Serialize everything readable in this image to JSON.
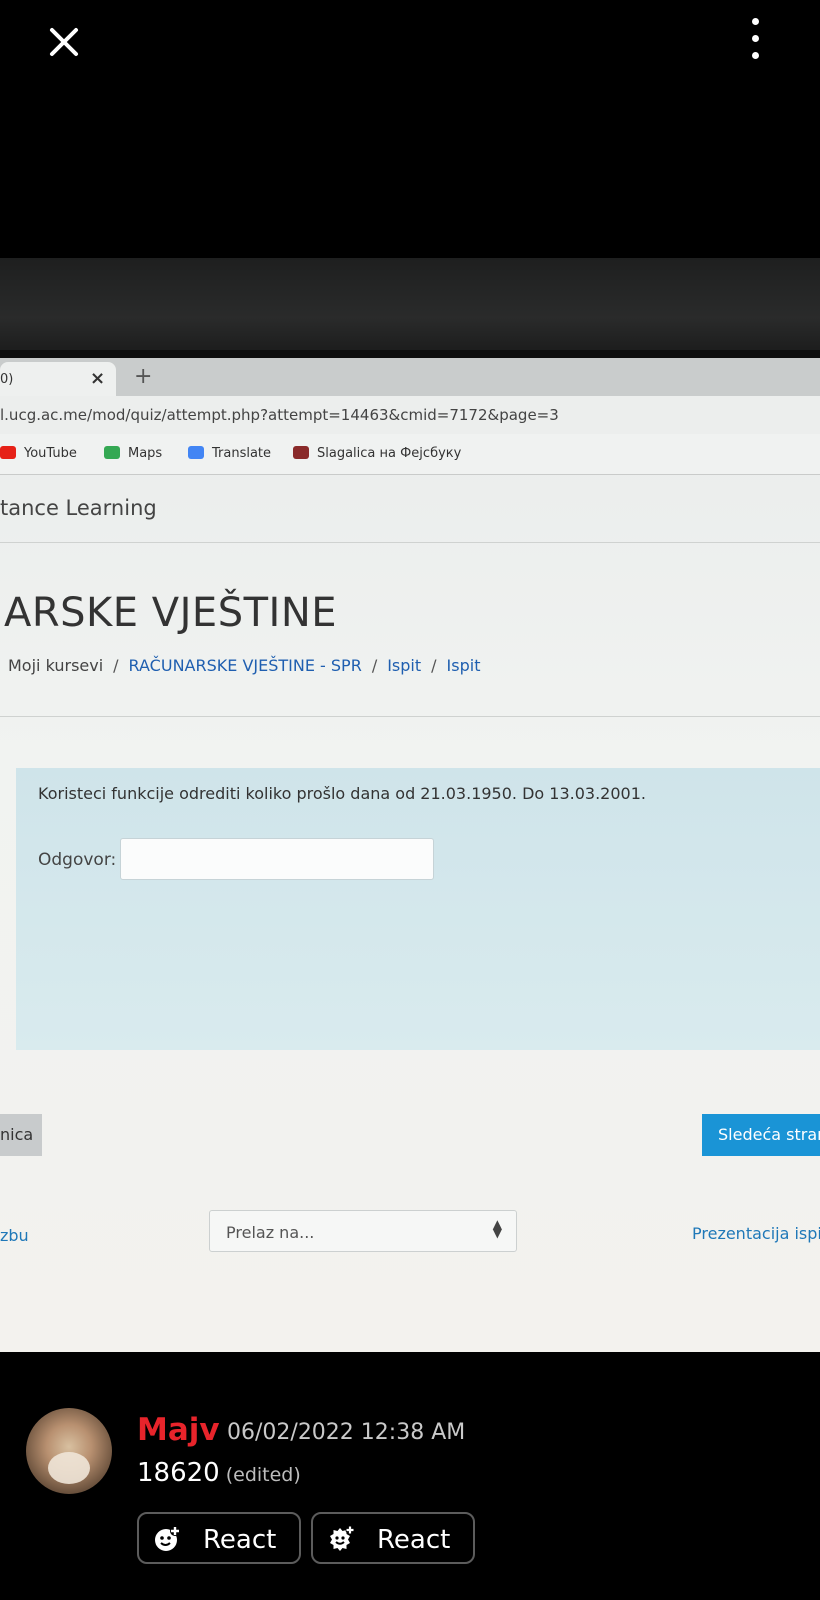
{
  "topbar": {
    "close_icon": "close-icon",
    "menu_icon": "more-vertical-icon"
  },
  "browser": {
    "tab_title": "0)",
    "url": "l.ucg.ac.me/mod/quiz/attempt.php?attempt=14463&cmid=7172&page=3",
    "bookmarks": [
      {
        "label": "YouTube",
        "color": "#e62117"
      },
      {
        "label": "Maps",
        "color": "#34a853"
      },
      {
        "label": "Translate",
        "color": "#4285f4"
      },
      {
        "label": "Slagalica на Фејсбуку",
        "color": "#8a2a2a"
      }
    ]
  },
  "page": {
    "site_name": "tance Learning",
    "course_title": "ARSKE VJEŠTINE",
    "breadcrumb": [
      "Moji kursevi",
      "RAČUNARSKE VJEŠTINE - SPR",
      "Ispit",
      "Ispit"
    ],
    "question": "Koristeci funkcije odrediti koliko prošlo dana od 21.03.1950. Do 13.03.2001.",
    "answer_label": "Odgovor:",
    "answer_value": "",
    "prev_button": "nica",
    "next_button": "Sledeća stran",
    "nav_left": "zbu",
    "jump_placeholder": "Prelaz na...",
    "nav_right": "Prezentacija ispit"
  },
  "post": {
    "username": "Majv",
    "username_color": "#e8242b",
    "timestamp": "06/02/2022 12:38 AM",
    "message": "18620",
    "edited": "(edited)",
    "react_buttons": [
      "React",
      "React"
    ]
  }
}
